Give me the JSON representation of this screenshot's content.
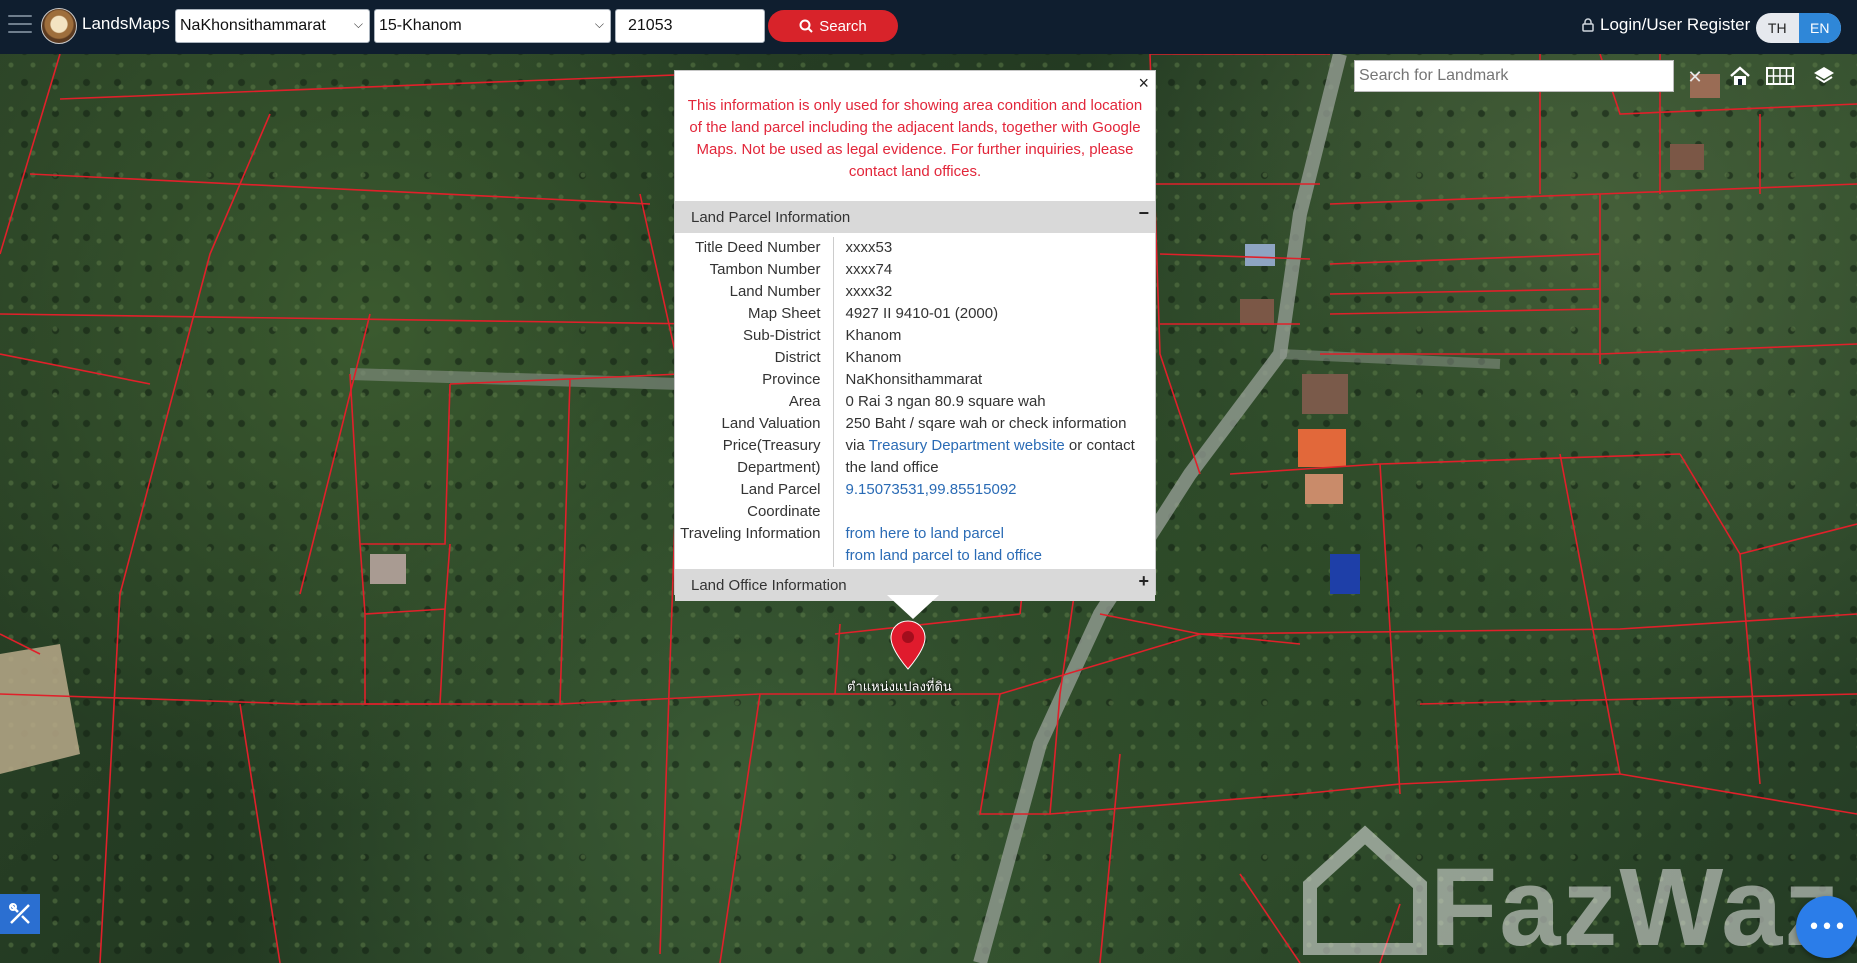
{
  "app": {
    "logo_text": "LandsMaps"
  },
  "header": {
    "province_select": "NaKhonsithammarat",
    "district_select": "15-Khanom",
    "parcel_input": "21053",
    "search_label": "Search",
    "login_label": "Login/User Register",
    "lang_th": "TH",
    "lang_en": "EN",
    "active_lang": "EN"
  },
  "map": {
    "landmark_placeholder": "Search for Landmark",
    "clear_label": "✕",
    "marker_label": "ตำแหน่งแปลงที่ดิน",
    "watermark_text": "FazWaz",
    "parcel_line_color": "#e0202a",
    "road_color": "#9aa19a"
  },
  "popup": {
    "close_label": "×",
    "disclaimer": "This information is only used for showing area condition and location of the land parcel including the adjacent lands, together with Google Maps. Not be used as legal evidence. For further inquiries, please contact land offices.",
    "section_parcel": "Land Parcel Information",
    "section_parcel_toggle": "−",
    "section_office": "Land Office Information",
    "section_office_toggle": "+",
    "rows": {
      "title_deed_label": "Title Deed Number",
      "title_deed_value": "xxxx53",
      "tambon_label": "Tambon Number",
      "tambon_value": "xxxx74",
      "land_number_label": "Land Number",
      "land_number_value": "xxxx32",
      "map_sheet_label": "Map Sheet",
      "map_sheet_value": "4927 II 9410-01 (2000)",
      "subdistrict_label": "Sub-District",
      "subdistrict_value": "Khanom",
      "district_label": "District",
      "district_value": "Khanom",
      "province_label": "Province",
      "province_value": "NaKhonsithammarat",
      "area_label": "Area",
      "area_value": "0 Rai 3 ngan 80.9 square wah",
      "valuation_label_1": "Land Valuation",
      "valuation_label_2": "Price(Treasury",
      "valuation_label_3": "Department)",
      "valuation_value_1": "250 Baht / sqare wah or check information",
      "valuation_value_2a": "via ",
      "valuation_link": "Treasury Department website",
      "valuation_value_2b": " or contact",
      "valuation_value_3": "the land office",
      "coord_label_1": "Land Parcel",
      "coord_label_2": "Coordinate",
      "coord_value": "9.15073531,99.85515092",
      "travel_label": "Traveling Information",
      "travel_link_1": "from here to land parcel",
      "travel_link_2": "from land parcel to land office"
    }
  },
  "icons": {
    "menu": "hamburger-icon",
    "search": "search-icon",
    "lock": "lock-icon",
    "home": "home-icon",
    "grid": "grid-icon",
    "layers": "layers-icon",
    "tools": "tools-icon",
    "chat": "chat-icon",
    "marker": "map-pin-icon"
  },
  "colors": {
    "topbar": "#0f1e2f",
    "search_button": "#d8232a",
    "lang_active": "#2f87d8",
    "disclaimer": "#e2263a",
    "link": "#2a6bb5",
    "marker": "#e01b2d"
  }
}
